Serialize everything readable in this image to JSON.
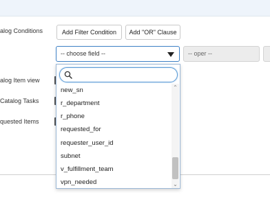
{
  "labels": {
    "catalog_conditions": "alog Conditions",
    "catalog_item_view": "alog Item view",
    "catalog_tasks": "Catalog Tasks",
    "requested_items": "quested Items"
  },
  "toolbar": {
    "add_filter_condition": "Add Filter Condition",
    "add_or_clause": "Add \"OR\" Clause"
  },
  "condition": {
    "field_selected": "-- choose field --",
    "operator_selected": "-- oper --"
  },
  "dropdown": {
    "search_value": "",
    "search_placeholder": "",
    "options": [
      "new_sn",
      "r_department",
      "r_phone",
      "requested_for",
      "requester_user_id",
      "subnet",
      "v_fulfillment_team",
      "vpn_needed"
    ]
  },
  "icons": {
    "search": "search-icon",
    "dropdown_caret": "chevron-down-icon",
    "scroll_up": "scroll-up-arrow-icon",
    "scroll_down": "scroll-down-arrow-icon"
  },
  "colors": {
    "focus_border": "#3b7fc4",
    "header_band": "#eef4fb",
    "disabled_fill": "#ececec"
  }
}
